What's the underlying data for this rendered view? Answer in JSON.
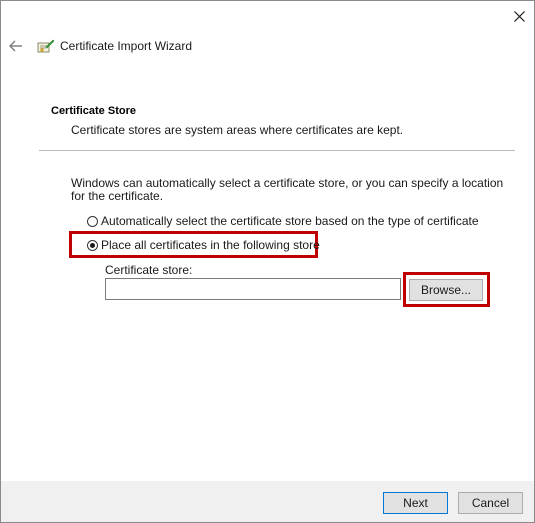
{
  "window": {
    "title": "Certificate Import Wizard",
    "close_glyph": "✕",
    "back_glyph": "←"
  },
  "section": {
    "heading": "Certificate Store",
    "description": "Certificate stores are system areas where certificates are kept."
  },
  "explanation": "Windows can automatically select a certificate store, or you can specify a location for the certificate.",
  "options": {
    "auto": {
      "label": "Automatically select the certificate store based on the type of certificate",
      "selected": false
    },
    "manual": {
      "label": "Place all certificates in the following store",
      "selected": true
    }
  },
  "store": {
    "label": "Certificate store:",
    "value": "",
    "browse_label": "Browse..."
  },
  "footer": {
    "next_label": "Next",
    "cancel_label": "Cancel"
  },
  "colors": {
    "highlight": "#c00000",
    "focus_border": "#0078d7"
  },
  "icons": [
    "close-icon",
    "back-arrow-icon",
    "certificate-wizard-icon"
  ]
}
